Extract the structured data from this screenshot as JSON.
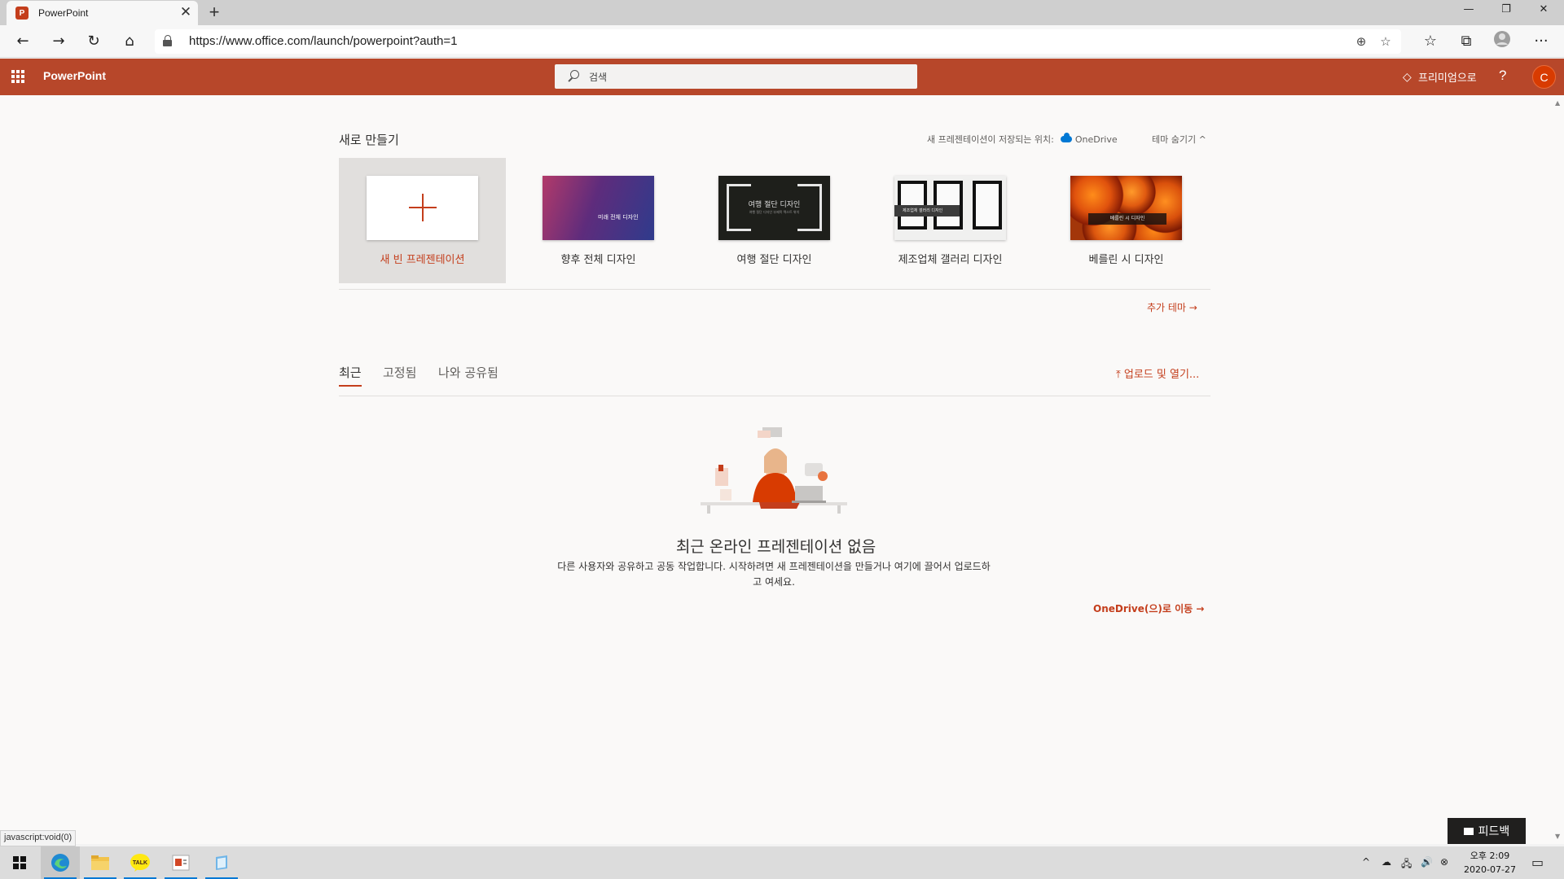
{
  "browser": {
    "tab_title": "PowerPoint",
    "tab_favicon_letter": "P",
    "tab_close": "✕",
    "new_tab": "+",
    "url": "https://www.office.com/launch/powerpoint?auth=1",
    "window_controls": {
      "minimize": "—",
      "restore": "❐",
      "close": "✕"
    },
    "nav": {
      "back": "←",
      "forward": "→",
      "refresh": "↻",
      "home": "⌂"
    },
    "toolbar_icons": {
      "add": "⊕",
      "favorite": "☆",
      "favorites": "☆",
      "collections": "⧉",
      "menu": "···"
    }
  },
  "office_header": {
    "app_name": "PowerPoint",
    "search_placeholder": "검색",
    "premium_label": "프리미엄으로",
    "help_label": "?",
    "avatar_letter": "C",
    "accent_color": "#b7472a"
  },
  "create_new": {
    "title": "새로 만들기",
    "save_location_label": "새 프레젠테이션이 저장되는 위치:",
    "save_location_service": "OneDrive",
    "hide_themes": "테마 숨기기 ^",
    "templates": [
      {
        "label": "새 빈 프레젠테이션"
      },
      {
        "label": "향후 전체 디자인",
        "thumb_text": "미래 전체 디자인"
      },
      {
        "label": "여행 절단 디자인",
        "thumb_text": "여행 절단 디자인",
        "thumb_sub": "여행 절단 디자인 부제목 텍스트 위치"
      },
      {
        "label": "제조업체 갤러리 디자인",
        "thumb_text": "제조업체 갤러리 디자인"
      },
      {
        "label": "베를린 시 디자인",
        "thumb_text": "베를린 시 디자인"
      }
    ],
    "more_themes": "추가 테마 →"
  },
  "files": {
    "tabs": [
      {
        "label": "최근",
        "active": true
      },
      {
        "label": "고정됨",
        "active": false
      },
      {
        "label": "나와 공유됨",
        "active": false
      }
    ],
    "upload_label": "⤒  업로드 및 열기..."
  },
  "empty_state": {
    "title": "최근 온라인 프레젠테이션 없음",
    "description": "다른 사용자와 공유하고 공동 작업합니다. 시작하려면 새 프레젠테이션을 만들거나 여기에 끌어서 업로드하고 여세요.",
    "goto_onedrive": "OneDrive(으)로 이동 →"
  },
  "status_hint": "javascript:void(0)",
  "feedback_label": "피드백",
  "taskbar": {
    "apps": [
      {
        "name": "edge-icon",
        "running": true,
        "active": true
      },
      {
        "name": "file-explorer-icon",
        "running": true,
        "active": false
      },
      {
        "name": "kakaotalk-icon",
        "running": true,
        "active": false,
        "text": "TALK"
      },
      {
        "name": "powerpoint-icon",
        "running": true,
        "active": false
      },
      {
        "name": "notepad-icon",
        "running": true,
        "active": false
      }
    ],
    "tray_icons": {
      "chevron": "^",
      "onedrive": "☁",
      "network": "🖧",
      "volume": "🔊",
      "ime": "⊗"
    },
    "time": "오후 2:09",
    "date": "2020-07-27",
    "notification": "▭"
  }
}
